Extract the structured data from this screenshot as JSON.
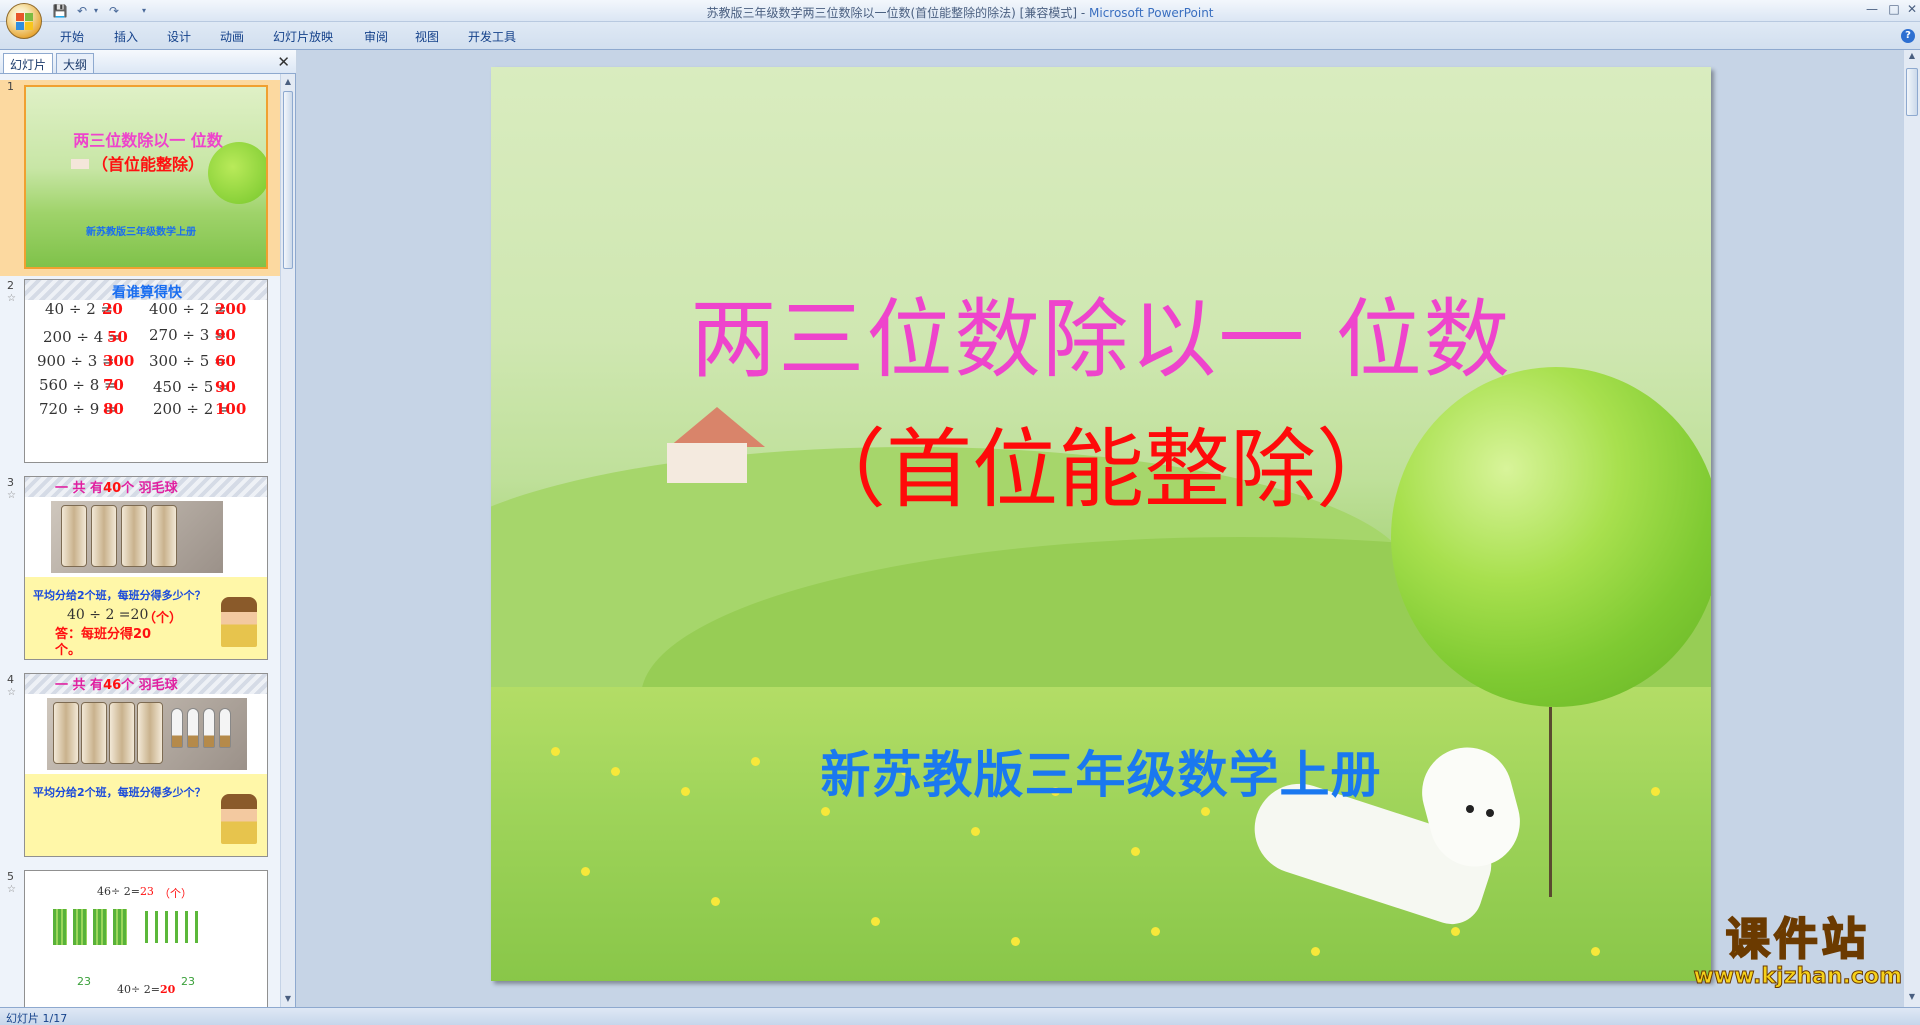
{
  "window": {
    "title": "苏教版三年级数学两三位数除以一位数(首位能整除的除法) [兼容模式] - ",
    "app_name": "Microsoft PowerPoint"
  },
  "ribbon": {
    "tabs": [
      "开始",
      "插入",
      "设计",
      "动画",
      "幻灯片放映",
      "审阅",
      "视图",
      "开发工具"
    ]
  },
  "left_pane": {
    "tabs": [
      "幻灯片",
      "大纲"
    ],
    "thumbnails": [
      {
        "number": "1",
        "title": "两三位数除以一 位数",
        "subtitle": "（首位能整除）",
        "credit": "新苏教版三年级数学上册"
      },
      {
        "number": "2",
        "heading": "看谁算得快",
        "problems": [
          {
            "eq": "40 ÷ 2 =",
            "ans": "20"
          },
          {
            "eq": "400 ÷ 2 =",
            "ans": "200"
          },
          {
            "eq": "200 ÷ 4 =",
            "ans": "50"
          },
          {
            "eq": "270 ÷ 3 =",
            "ans": "90"
          },
          {
            "eq": "900 ÷ 3 =",
            "ans": "300"
          },
          {
            "eq": "300 ÷ 5 =",
            "ans": "60"
          },
          {
            "eq": "560 ÷ 8 =",
            "ans": "70"
          },
          {
            "eq": "450 ÷ 5 =",
            "ans": "90"
          },
          {
            "eq": "720 ÷ 9 =",
            "ans": "80"
          },
          {
            "eq": "200 ÷ 2 =",
            "ans": "100"
          }
        ]
      },
      {
        "number": "3",
        "heading_prefix": "一 共 有",
        "heading_num": "40",
        "heading_suffix": "个 羽毛球",
        "question": "平均分给2个班，每班分得多少个？",
        "equation": "40 ÷ 2 =20",
        "unit": "（个）",
        "answer": "答：每班分得20个。"
      },
      {
        "number": "4",
        "heading_prefix": "一 共 有",
        "heading_num": "46",
        "heading_suffix": "个 羽毛球",
        "question": "平均分给2个班，每班分得多少个？"
      },
      {
        "number": "5",
        "eq_prefix": "46÷ 2=",
        "eq_answer": "23",
        "unit": "（个）",
        "brace_left": "23",
        "brace_right": "23",
        "eq2_prefix": "40÷ 2=",
        "eq2_answer": "20"
      }
    ]
  },
  "slide": {
    "title": "两三位数除以一 位数",
    "subtitle": "（首位能整除）",
    "credit": "新苏教版三年级数学上册"
  },
  "watermark": {
    "line1": "课件站",
    "line2": "www.kjzhan.com"
  },
  "status": {
    "slide_indicator": "幻灯片 1/17"
  },
  "colors": {
    "title_pink": "#ee44cc",
    "subtitle_red": "#ff0a0a",
    "credit_blue": "#1a78f0",
    "ribbon_text": "#15428b"
  }
}
